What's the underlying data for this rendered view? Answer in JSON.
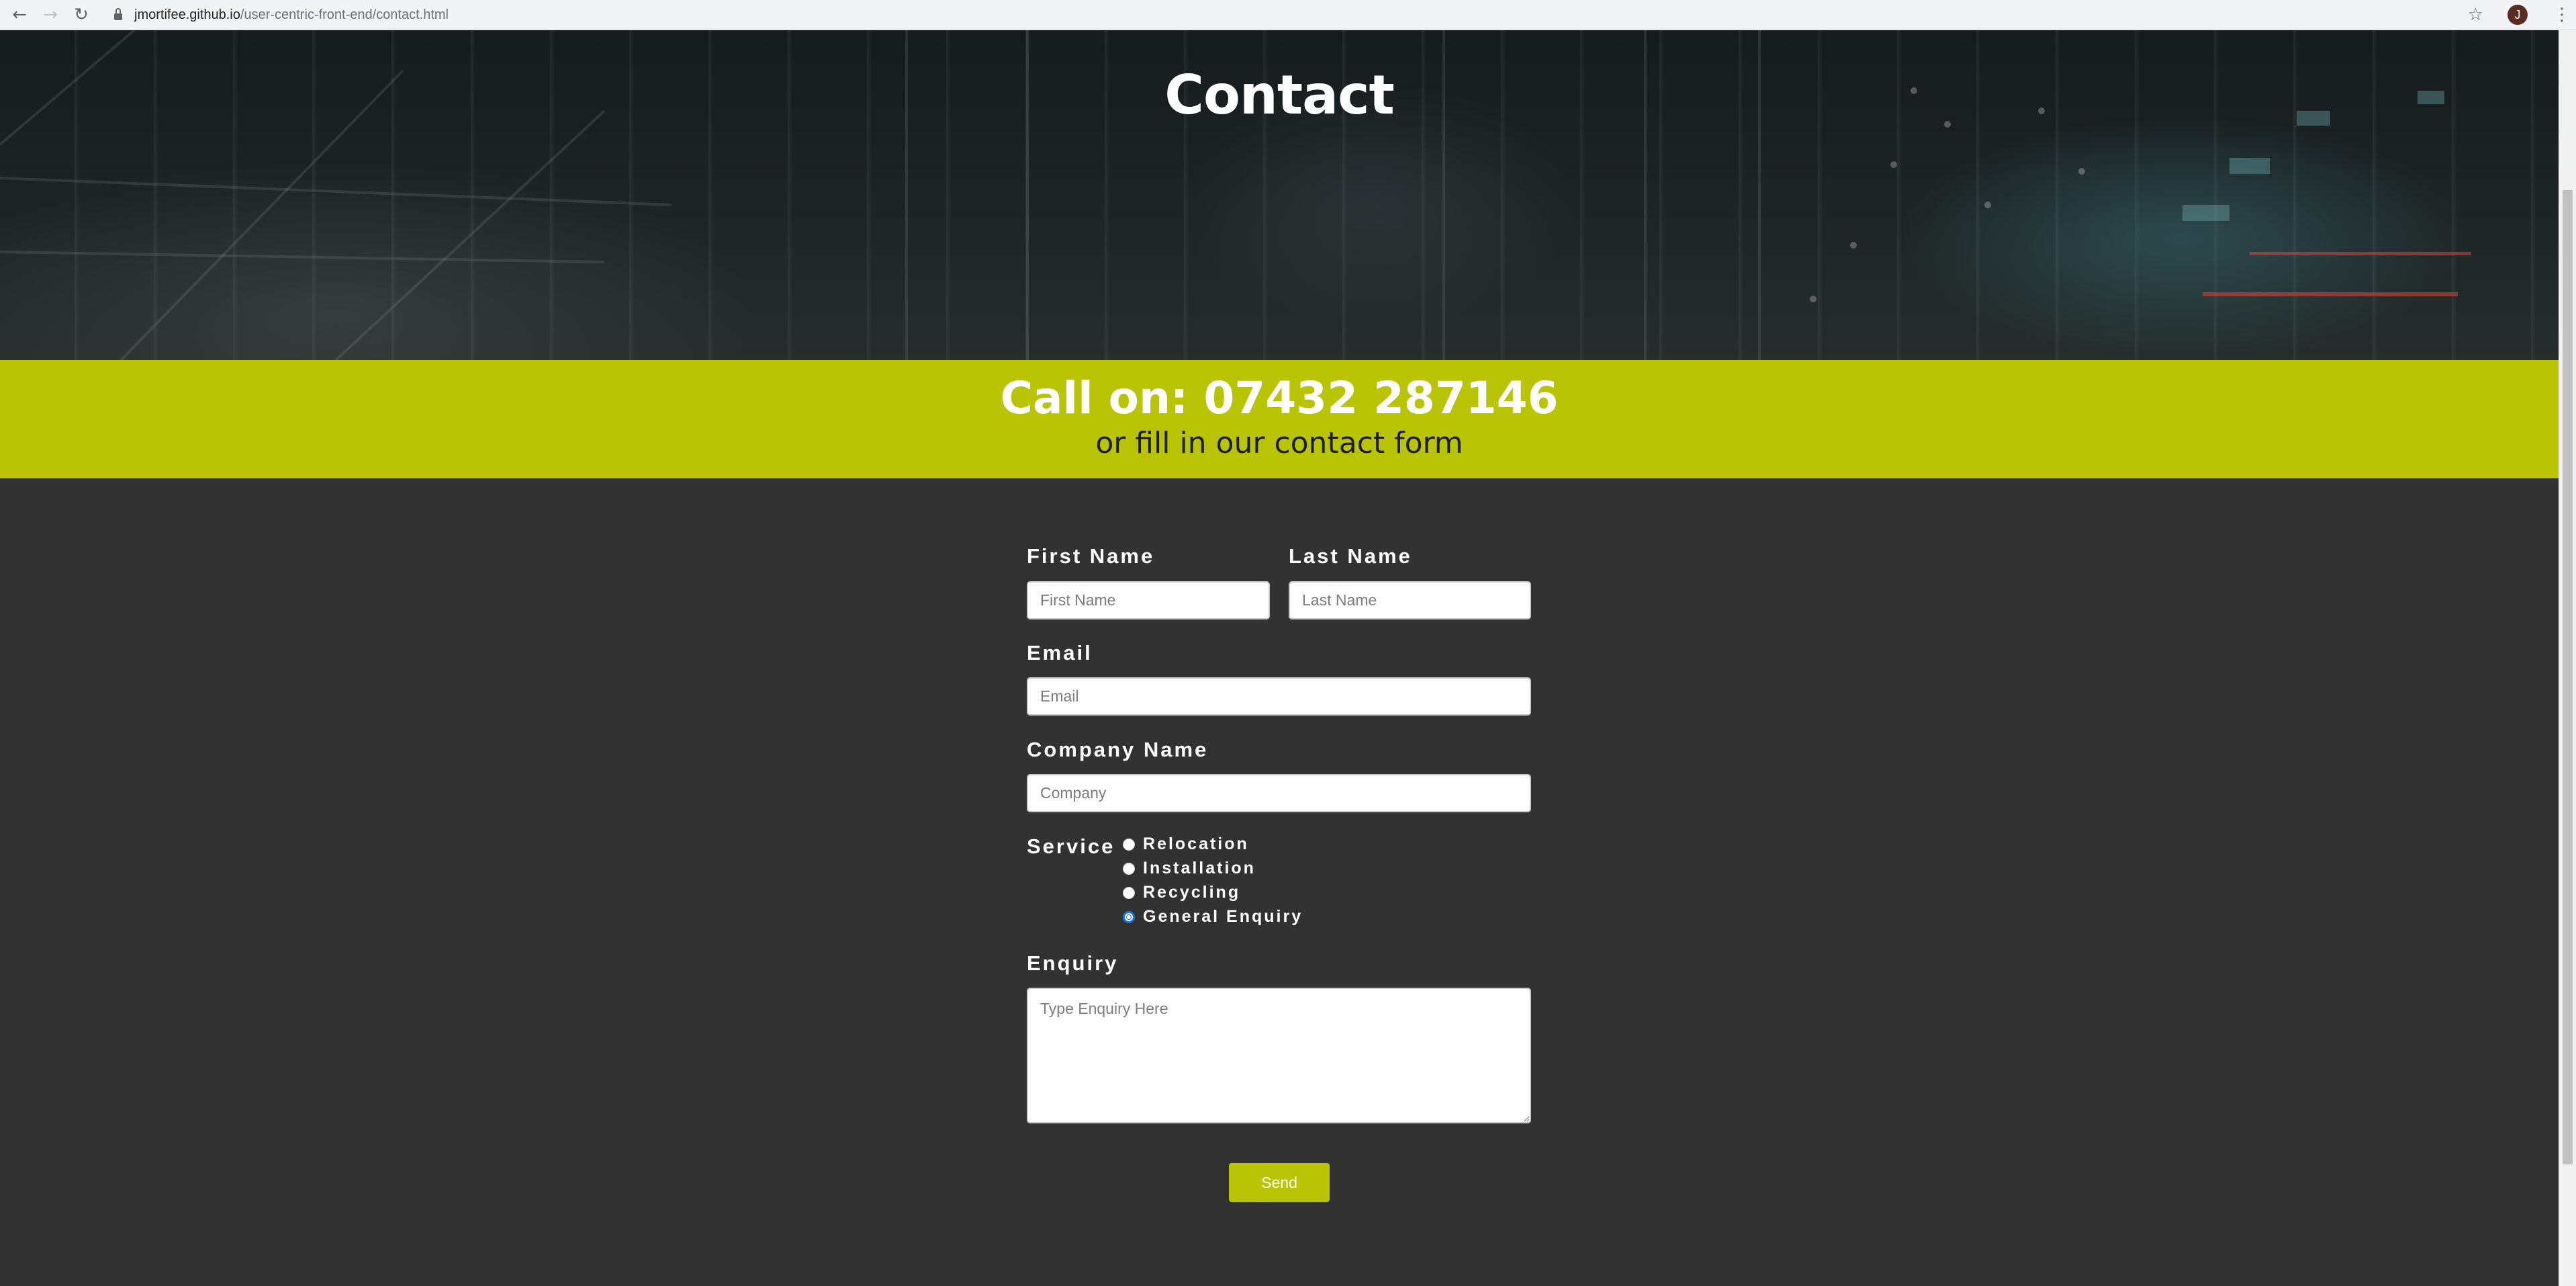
{
  "browser": {
    "url_host": "jmortifee.github.io",
    "url_path": "/user-centric-front-end/contact.html",
    "back_icon": "←",
    "forward_icon": "→",
    "reload_icon": "↻",
    "star_icon": "☆",
    "avatar_initial": "J",
    "menu_icon": "⋮"
  },
  "hero": {
    "title": "Contact"
  },
  "call": {
    "line": "Call on: 07432 287146",
    "sub": "or fill in our contact form"
  },
  "form": {
    "first_name": {
      "label": "First Name",
      "placeholder": "First Name",
      "value": ""
    },
    "last_name": {
      "label": "Last Name",
      "placeholder": "Last Name",
      "value": ""
    },
    "email": {
      "label": "Email",
      "placeholder": "Email",
      "value": ""
    },
    "company": {
      "label": "Company Name",
      "placeholder": "Company",
      "value": ""
    },
    "service": {
      "label": "Service",
      "options": [
        "Relocation",
        "Installation",
        "Recycling",
        "General Enquiry"
      ],
      "selected": "General Enquiry"
    },
    "enquiry": {
      "label": "Enquiry",
      "placeholder": "Type Enquiry Here",
      "value": ""
    },
    "send_label": "Send"
  },
  "colors": {
    "accent": "#b8c404",
    "background": "#323232",
    "radio_selected": "#1a73e8"
  }
}
